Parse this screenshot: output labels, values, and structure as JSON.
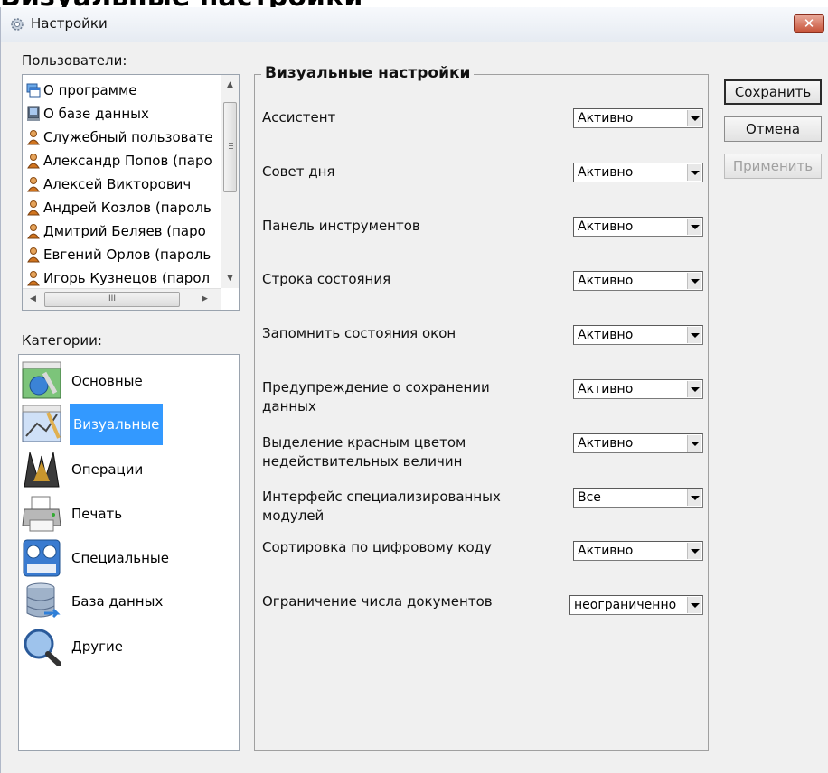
{
  "clipped_heading": "Визуальные настройки",
  "window": {
    "title": "Настройки",
    "close_label": "✕"
  },
  "users": {
    "label": "Пользователи:",
    "items": [
      {
        "text": "О программе",
        "icon": "about-icon"
      },
      {
        "text": "О базе данных",
        "icon": "database-icon"
      },
      {
        "text": "Служебный пользовате",
        "icon": "user-icon"
      },
      {
        "text": "Александр Попов (паро",
        "icon": "user-icon"
      },
      {
        "text": "Алексей Викторович",
        "icon": "user-icon"
      },
      {
        "text": "Андрей Козлов (пароль",
        "icon": "user-icon"
      },
      {
        "text": "Дмитрий Беляев (паро",
        "icon": "user-icon"
      },
      {
        "text": "Евгений Орлов (пароль",
        "icon": "user-icon"
      },
      {
        "text": "Игорь Кузнецов (парол",
        "icon": "user-icon"
      }
    ],
    "hscroll_thumb": "III"
  },
  "categories": {
    "label": "Категории:",
    "items": [
      {
        "text": "Основные",
        "icon": "main-settings-icon",
        "selected": false
      },
      {
        "text": "Визуальные",
        "icon": "visual-settings-icon",
        "selected": true
      },
      {
        "text": "Операции",
        "icon": "operations-icon",
        "selected": false
      },
      {
        "text": "Печать",
        "icon": "printer-icon",
        "selected": false
      },
      {
        "text": "Специальные",
        "icon": "special-settings-icon",
        "selected": false
      },
      {
        "text": "База данных",
        "icon": "database-cylinder-icon",
        "selected": false
      },
      {
        "text": "Другие",
        "icon": "magnifier-icon",
        "selected": false
      }
    ]
  },
  "visual": {
    "title": "Визуальные настройки",
    "options": [
      {
        "label": "Ассистент",
        "value": "Активно"
      },
      {
        "label": "Совет дня",
        "value": "Активно"
      },
      {
        "label": "Панель инструментов",
        "value": "Активно"
      },
      {
        "label": "Строка состояния",
        "value": "Активно"
      },
      {
        "label": "Запомнить состояния окон",
        "value": "Активно"
      },
      {
        "label": "Предупреждение о сохранении данных",
        "value": "Активно"
      },
      {
        "label": "Выделение красным цветом недействительных величин",
        "value": "Активно"
      },
      {
        "label": "Интерфейс специализированных модулей",
        "value": "Все"
      },
      {
        "label": "Сортировка по цифровому  коду",
        "value": "Активно"
      },
      {
        "label": "Ограничение числа документов",
        "value": "неограниченно"
      }
    ]
  },
  "buttons": {
    "save": "Сохранить",
    "cancel": "Отмена",
    "apply": "Применить"
  }
}
